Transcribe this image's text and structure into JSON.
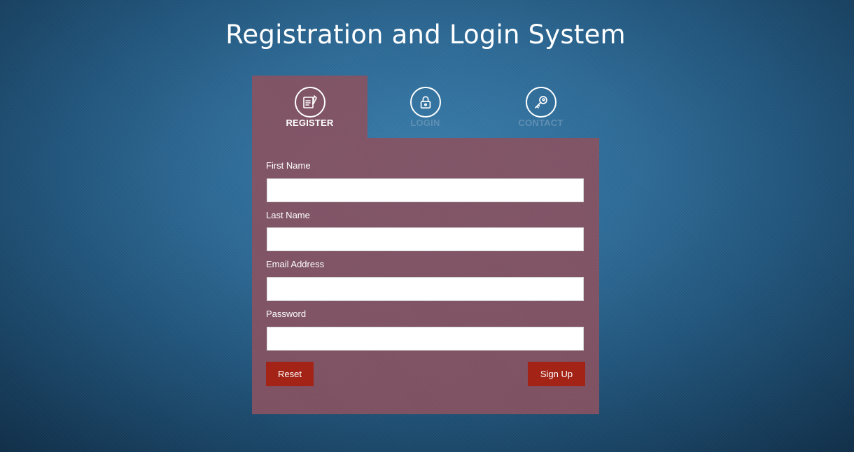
{
  "page": {
    "title": "Registration and Login System"
  },
  "tabs": [
    {
      "label": "REGISTER",
      "icon": "register-form-icon",
      "active": true
    },
    {
      "label": "LOGIN",
      "icon": "lock-icon",
      "active": false
    },
    {
      "label": "CONTACT",
      "icon": "key-icon",
      "active": false
    }
  ],
  "form": {
    "fields": [
      {
        "label": "First Name",
        "value": ""
      },
      {
        "label": "Last Name",
        "value": ""
      },
      {
        "label": "Email Address",
        "value": ""
      },
      {
        "label": "Password",
        "value": ""
      }
    ],
    "reset_label": "Reset",
    "signup_label": "Sign Up"
  },
  "colors": {
    "panel": "#865060",
    "button": "#a32317",
    "inactive_tab_text": "#5f8fb3",
    "background": "#2d6a96"
  }
}
